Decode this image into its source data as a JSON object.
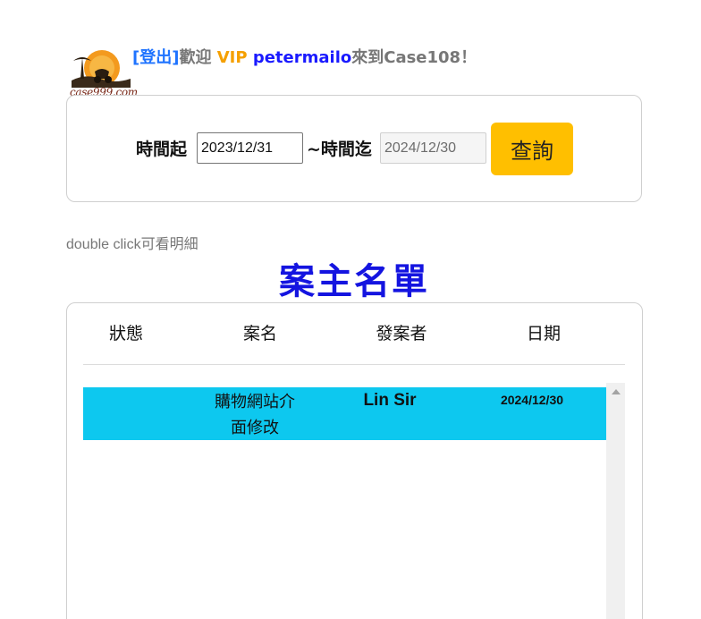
{
  "header": {
    "logo_text": "case999.com",
    "logout_label": "[登出]",
    "welcome_prefix": "歡迎 ",
    "vip_label": "VIP",
    "username": "petermailo",
    "welcome_suffix": "來到Case108！"
  },
  "search": {
    "from_label": "時間起",
    "from_value": "2023/12/31",
    "to_label": "~時間迄",
    "to_value": "2024/12/30",
    "query_button": "查詢"
  },
  "hint": "double click可看明細",
  "title": "案主名單",
  "table": {
    "columns": [
      "狀態",
      "案名",
      "發案者",
      "日期"
    ],
    "rows": [
      {
        "status": "",
        "name_line1": "購物網站介",
        "name_line2": "面修改",
        "owner": "Lin Sir",
        "date": "2024/12/30"
      }
    ]
  },
  "colors": {
    "accent_blue": "#1414e0",
    "button_yellow": "#ffbf00",
    "row_highlight": "#0dc8ef",
    "vip_orange": "#f5a000"
  }
}
